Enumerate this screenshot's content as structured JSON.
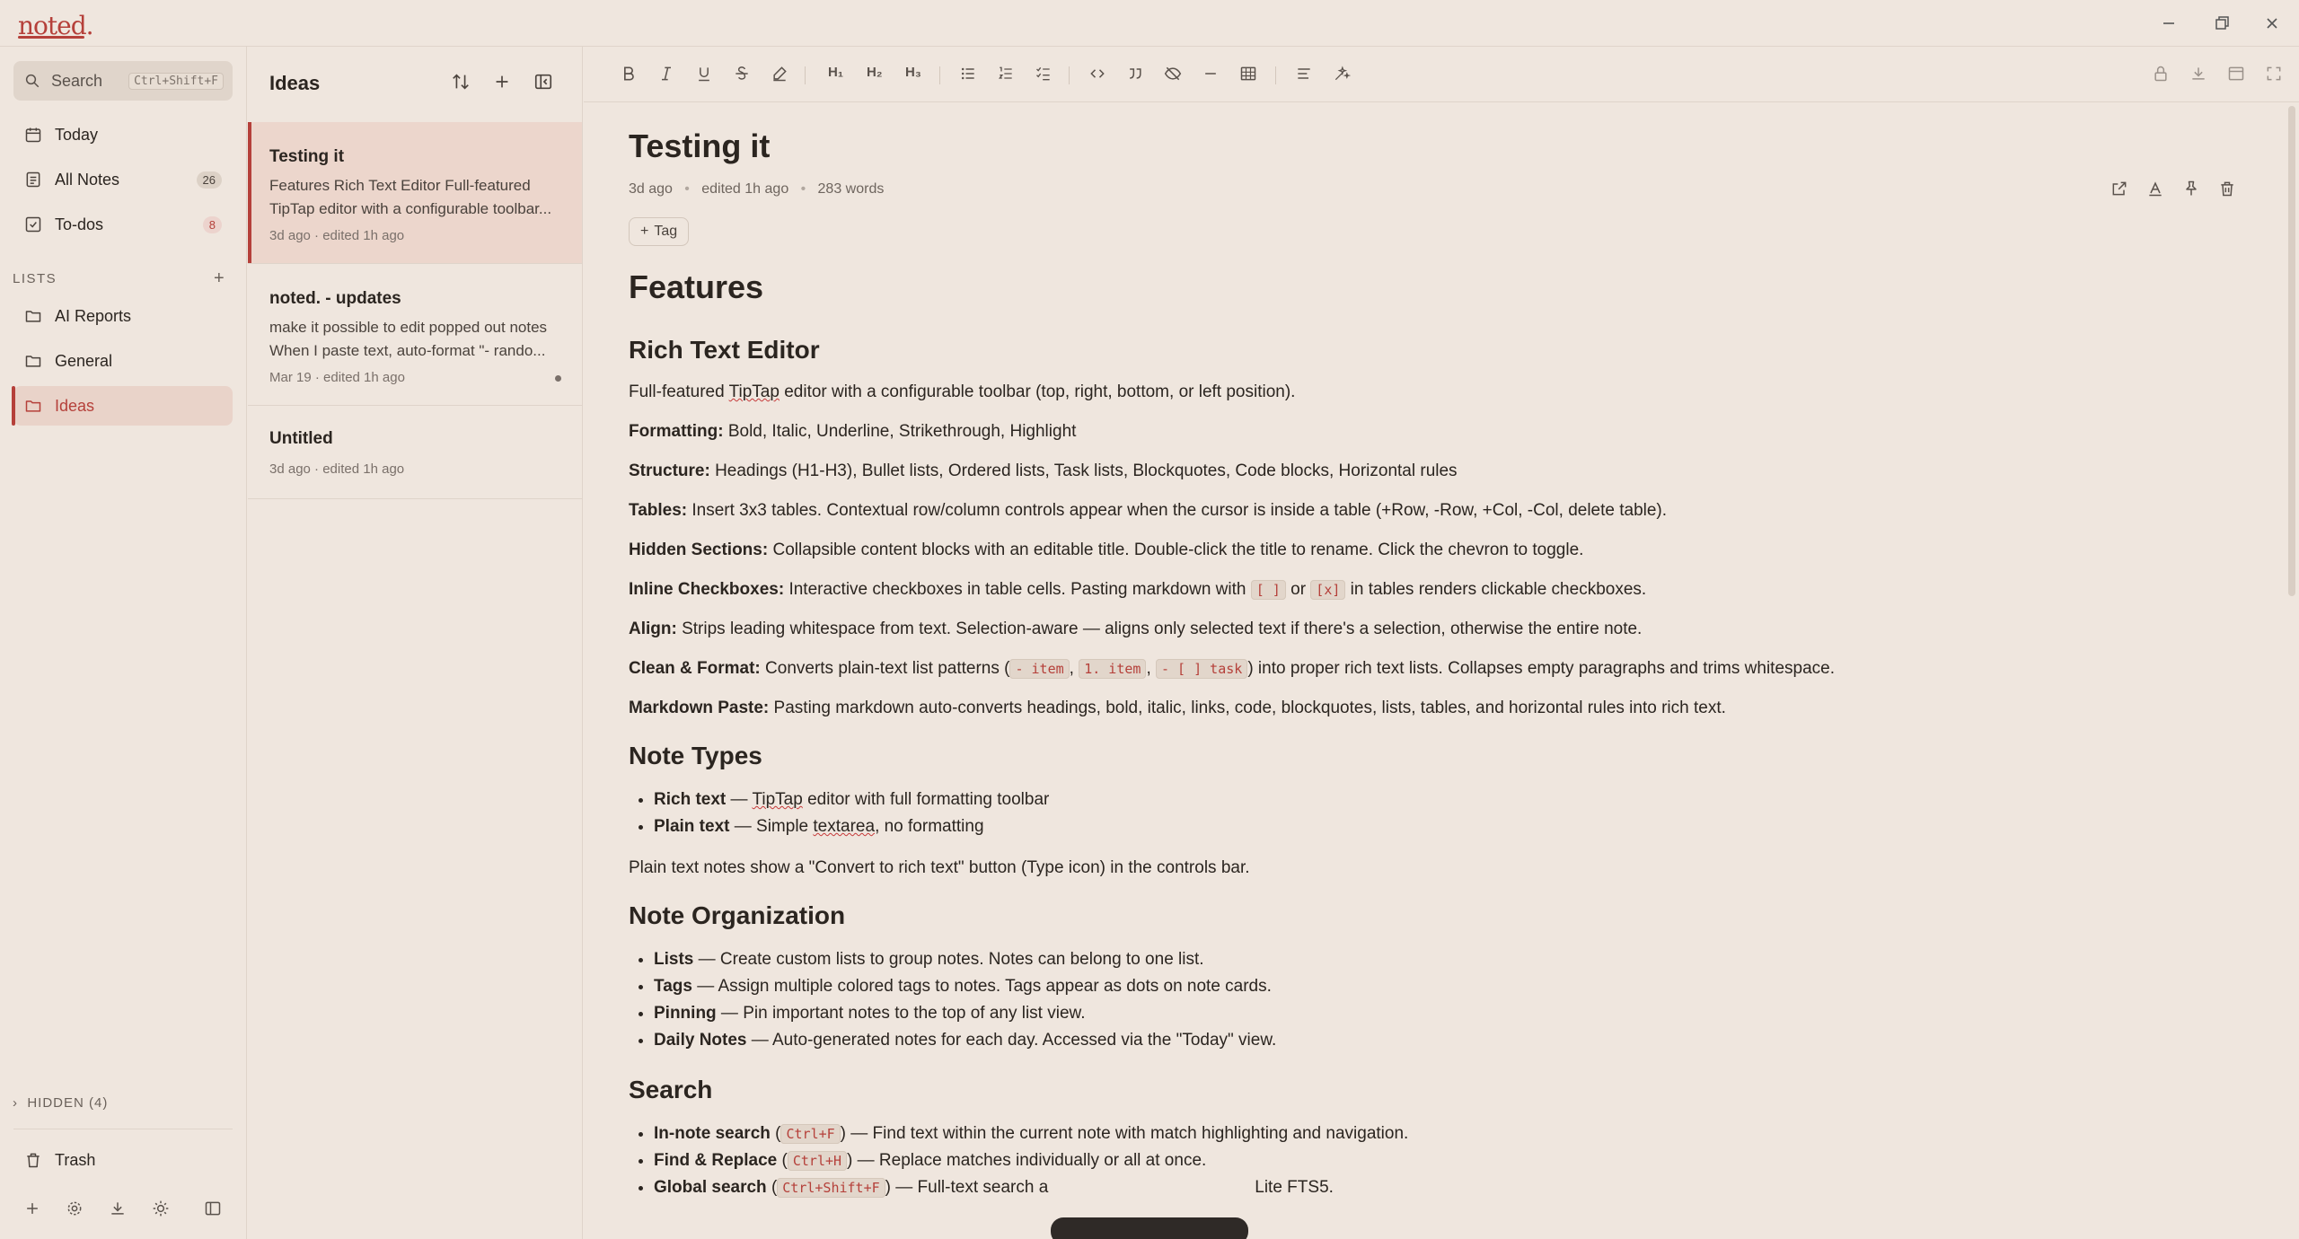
{
  "app": {
    "logo": "noted."
  },
  "sidebar": {
    "search": {
      "label": "Search",
      "shortcut": "Ctrl+Shift+F"
    },
    "nav": [
      {
        "label": "Today",
        "icon": "calendar-icon"
      },
      {
        "label": "All Notes",
        "icon": "note-icon",
        "count": "26"
      },
      {
        "label": "To-dos",
        "icon": "checkbox-icon",
        "count": "8"
      }
    ],
    "lists_header": "LISTS",
    "lists": [
      {
        "label": "AI Reports",
        "icon": "folder-icon"
      },
      {
        "label": "General",
        "icon": "folder-icon"
      },
      {
        "label": "Ideas",
        "icon": "folder-icon",
        "active": true
      }
    ],
    "hidden_label": "HIDDEN (4)",
    "trash_label": "Trash"
  },
  "notelist": {
    "title": "Ideas",
    "cards": [
      {
        "title": "Testing it",
        "preview": "Features Rich Text Editor Full-featured TipTap editor with a configurable toolbar...",
        "date": "3d ago · edited 1h ago"
      },
      {
        "title": "noted. - updates",
        "preview": "make it possible to edit popped out notes When I paste text, auto-format \"- rando...",
        "date": "Mar 19 · edited 1h ago"
      },
      {
        "title": "Untitled",
        "preview": "",
        "date": "3d ago · edited 1h ago"
      }
    ]
  },
  "editor": {
    "title": "Testing it",
    "meta": {
      "created": "3d ago",
      "edited": "edited 1h ago",
      "words": "283 words"
    },
    "tag_button": "Tag",
    "content": {
      "h_features": "Features",
      "h_rich": "Rich Text Editor",
      "p_rich_intro_a": "Full-featured ",
      "p_rich_intro_tiptap": "TipTap",
      "p_rich_intro_b": " editor with a configurable toolbar (top, right, bottom, or left position).",
      "formatting_label": "Formatting:",
      "formatting_text": " Bold, Italic, Underline, Strikethrough, Highlight",
      "structure_label": "Structure:",
      "structure_text": " Headings (H1-H3), Bullet lists, Ordered lists, Task lists, Blockquotes, Code blocks, Horizontal rules",
      "tables_label": "Tables:",
      "tables_text": " Insert 3x3 tables. Contextual row/column controls appear when the cursor is inside a table (+Row, -Row, +Col, -Col, delete table).",
      "hidden_label": "Hidden Sections:",
      "hidden_text": " Collapsible content blocks with an editable title. Double-click the title to rename. Click the chevron to toggle.",
      "inline_label": "Inline Checkboxes:",
      "inline_text_a": " Interactive checkboxes in table cells. Pasting markdown with ",
      "inline_code1": "[ ]",
      "inline_text_b": " or ",
      "inline_code2": "[x]",
      "inline_text_c": " in tables renders clickable checkboxes.",
      "align_label": "Align:",
      "align_text": " Strips leading whitespace from text. Selection-aware — aligns only selected text if there's a selection, otherwise the entire note.",
      "clean_label": "Clean & Format:",
      "clean_text_a": " Converts plain-text list patterns (",
      "clean_code1": "- item",
      "clean_sep1": ", ",
      "clean_code2": "1. item",
      "clean_sep2": ", ",
      "clean_code3": "- [ ] task",
      "clean_text_b": ") into proper rich text lists. Collapses empty paragraphs and trims whitespace.",
      "md_label": "Markdown Paste:",
      "md_text": " Pasting markdown auto-converts headings, bold, italic, links, code, blockquotes, lists, tables, and horizontal rules into rich text.",
      "h_types": "Note Types",
      "types_rich_label": "Rich text",
      "types_rich_text_a": " — ",
      "types_rich_tiptap": "TipTap",
      "types_rich_text_b": " editor with full formatting toolbar",
      "types_plain_label": "Plain text",
      "types_plain_text_a": " — Simple ",
      "types_plain_textarea": "textarea",
      "types_plain_text_b": ", no formatting",
      "types_note": "Plain text notes show a \"Convert to rich text\" button (Type icon) in the controls bar.",
      "h_org": "Note Organization",
      "org": [
        {
          "label": "Lists",
          "text": " — Create custom lists to group notes. Notes can belong to one list."
        },
        {
          "label": "Tags",
          "text": " — Assign multiple colored tags to notes. Tags appear as dots on note cards."
        },
        {
          "label": "Pinning",
          "text": " — Pin important notes to the top of any list view."
        },
        {
          "label": "Daily Notes",
          "text": " — Auto-generated notes for each day. Accessed via the \"Today\" view."
        }
      ],
      "h_search": "Search",
      "s1_label": "In-note search",
      "s1_a": " (",
      "s1_code": "Ctrl+F",
      "s1_b": ") — Find text within the current note with match highlighting and navigation.",
      "s2_label": "Find & Replace",
      "s2_a": " (",
      "s2_code": "Ctrl+H",
      "s2_b": ") — Replace matches individually or all at once.",
      "s3_label": "Global search",
      "s3_a": " (",
      "s3_code": "Ctrl+Shift+F",
      "s3_b": ") — Full-text search a",
      "s3_c": "Lite FTS5."
    }
  },
  "colors": {
    "accent": "#b5403a",
    "background": "#efe6de"
  }
}
